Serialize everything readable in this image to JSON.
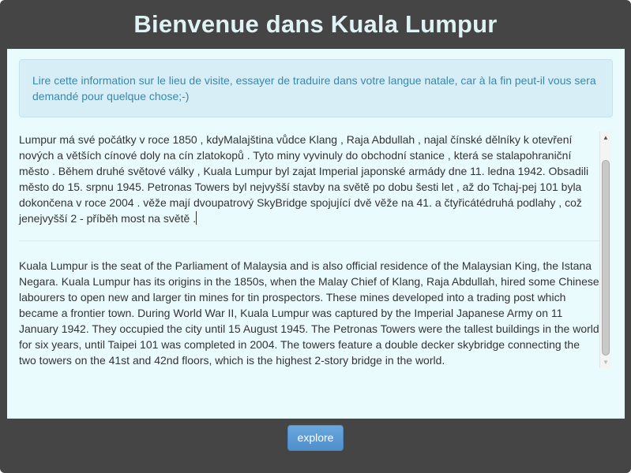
{
  "header": {
    "title": "Bienvenue dans Kuala Lumpur"
  },
  "alert": {
    "text": "Lire cette information sur le lieu de visite, essayer de traduire dans votre langue natale, car à la fin peut-il vous sera demandé pour quelque chose;-)"
  },
  "textarea": {
    "czech_text": "Lumpur má své počátky v roce 1850 , kdyMalajština vůdce Klang , Raja Abdullah , najal čínské dělníky k otevření nových a větších cínové doly na cín zlatokopů . Tyto miny vyvinuly do obchodní stanice , která se stalapohraniční město . Během druhé světové války , Kuala Lumpur byl zajat Imperial japonské armády dne 11. ledna 1942. Obsadili město do 15. srpnu 1945. Petronas Towers byl nejvyšší stavby na světě po dobu šesti let , až do Tchaj-pej 101 byla dokončena v roce 2004 . věže mají dvoupatrový SkyBridge spojující dvě věže na 41. a čtyřicátédruhá podlahy , což jenejvyšší 2 - příběh most na světě .",
    "english_text": "Kuala Lumpur is the seat of the Parliament of Malaysia and is also official residence of the Malaysian King, the Istana Negara. Kuala Lumpur has its origins in the 1850s, when the Malay Chief of Klang, Raja Abdullah, hired some Chinese labourers to open new and larger tin mines for tin prospectors. These mines developed into a trading post which became a frontier town. During World War II, Kuala Lumpur was captured by the Imperial Japanese Army on 11 January 1942. They occupied the city until 15 August 1945. The Petronas Towers were the tallest buildings in the world for six years, until Taipei 101 was completed in 2004. The towers feature a double decker skybridge connecting the two towers on the 41st and 42nd floors, which is the highest 2-story bridge in the world."
  },
  "footer": {
    "explore_label": "explore"
  },
  "colors": {
    "window_bg": "#454545",
    "title_color": "#dff3f5",
    "content_bg": "#eafbfd",
    "alert_bg": "#d8eef7",
    "alert_text": "#3a87ad",
    "button_bg": "#5b9bd5"
  }
}
